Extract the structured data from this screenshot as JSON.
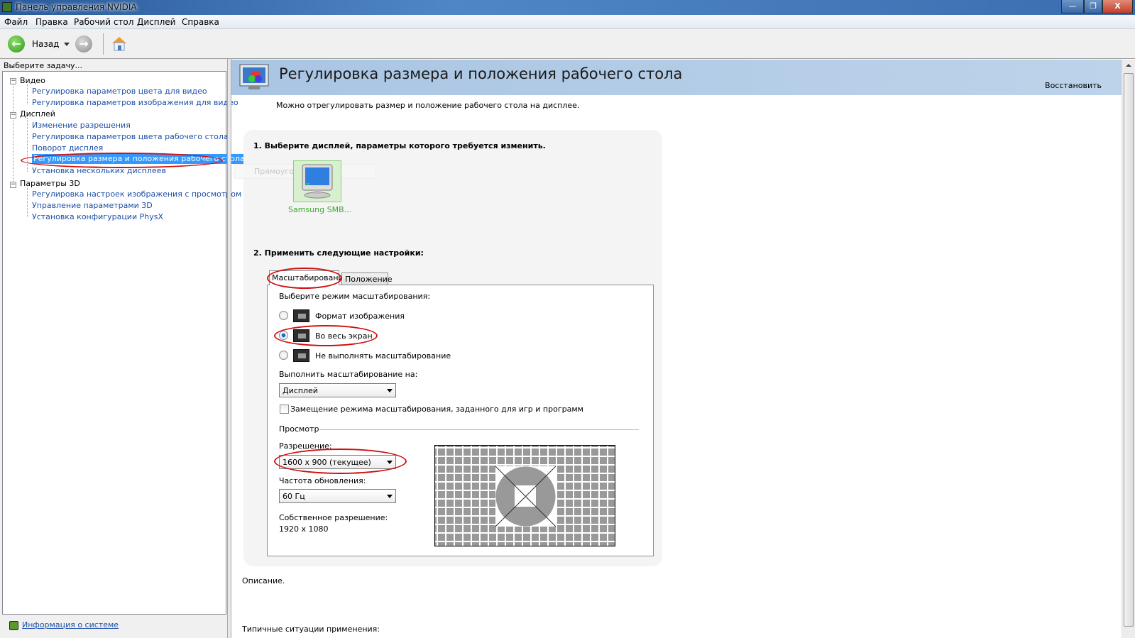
{
  "window": {
    "title": "Панель управления NVIDIA",
    "controls": {
      "minimize": "—",
      "restore": "❐",
      "close": "X"
    }
  },
  "menu": [
    "Файл",
    "Правка",
    "Рабочий стол",
    "Дисплей",
    "Справка"
  ],
  "toolbar": {
    "back_label": "Назад",
    "back_icon": "arrow-left-icon",
    "forward_icon": "arrow-right-icon",
    "home_icon": "home-icon"
  },
  "sidebar": {
    "title": "Выберите задачу...",
    "groups": [
      {
        "label": "Видео",
        "items": [
          "Регулировка параметров цвета для видео",
          "Регулировка параметров изображения для видео"
        ]
      },
      {
        "label": "Дисплей",
        "items": [
          "Изменение разрешения",
          "Регулировка параметров цвета рабочего стола",
          "Поворот дисплея",
          "Регулировка размера и положения рабочего стола",
          "Установка нескольких дисплеев"
        ]
      },
      {
        "label": "Параметры 3D",
        "items": [
          "Регулировка настроек изображения с просмотром",
          "Управление параметрами 3D",
          "Установка конфигурации PhysX"
        ]
      }
    ],
    "selected": "Регулировка размера и положения рабочего стола",
    "system_info": "Информация о системе"
  },
  "page": {
    "title": "Регулировка размера и положения рабочего стола",
    "restore": "Восстановить",
    "subtitle": "Можно отрегулировать размер и положение рабочего стола на дисплее.",
    "step1": "1. Выберите дисплей, параметры которого требуется изменить.",
    "display_name": "Samsung SMB...",
    "tooltip": "Прямоугольник",
    "step2": "2. Применить следующие настройки:",
    "tabs": [
      "Масштабирование",
      "Положение"
    ],
    "scaling_prompt": "Выберите режим масштабирования:",
    "modes": [
      {
        "label": "Формат изображения",
        "selected": false
      },
      {
        "label": "Во весь экран",
        "selected": true
      },
      {
        "label": "Не выполнять масштабирование",
        "selected": false
      }
    ],
    "scale_on_label": "Выполнить масштабирование на:",
    "scale_on_value": "Дисплей",
    "override_label": "Замещение режима масштабирования, заданного для игр и программ",
    "override_checked": false,
    "preview_label": "Просмотр",
    "resolution_label": "Разрешение:",
    "resolution_value": "1600 x 900 (текущее)",
    "refresh_label": "Частота обновления:",
    "refresh_value": "60 Гц",
    "native_label": "Собственное разрешение:",
    "native_value": "1920 x 1080",
    "description": "Описание.",
    "typical": "Типичные ситуации применения:"
  },
  "colors": {
    "accent": "#3399ff",
    "annotation": "#d01010",
    "link": "#1c4fa8"
  }
}
